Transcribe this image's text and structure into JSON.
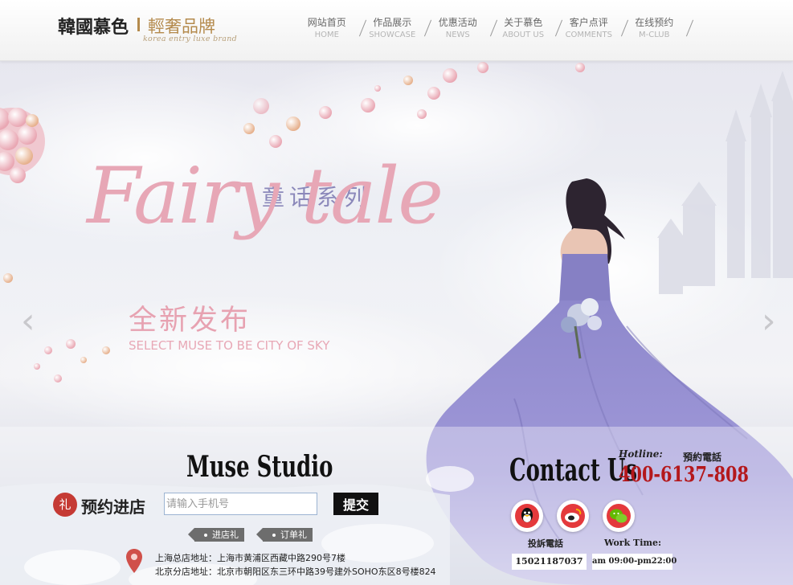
{
  "header": {
    "logo": {
      "main": "韓國慕色",
      "sub": "輕奢品牌",
      "tagline": "korea entry luxe brand"
    },
    "nav": [
      {
        "label": "网站首页",
        "sublabel": "HOME"
      },
      {
        "label": "作品展示",
        "sublabel": "SHOWCASE"
      },
      {
        "label": "优惠活动",
        "sublabel": "NEWS"
      },
      {
        "label": "关于慕色",
        "sublabel": "ABOUT US"
      },
      {
        "label": "客户点评",
        "sublabel": "COMMENTS"
      },
      {
        "label": "在线预约",
        "sublabel": "M-CLUB"
      }
    ]
  },
  "banner": {
    "series": "童话系列",
    "script": "Fairy tale",
    "headline": "全新发布",
    "tagline": "SELECT MUSE TO BE CITY OF SKY",
    "prev_icon": "chevron-left-icon",
    "next_icon": "chevron-right-icon",
    "prev_glyph": "‹",
    "next_glyph": "›"
  },
  "booking": {
    "studio_title": "Muse Studio",
    "gift_icon": "礼",
    "label": "预约进店",
    "phone_placeholder": "请输入手机号",
    "submit_label": "提交",
    "tags": [
      "进店礼",
      "订单礼"
    ],
    "address_shanghai": "上海总店地址：上海市黄浦区西藏中路290号7楼",
    "address_beijing": "北京分店地址：北京市朝阳区东三环中路39号建外SOHO东区8号楼824"
  },
  "contact": {
    "title": "Contact Us",
    "hotline_label": "Hotline:",
    "hotline_cn": "預約電話",
    "hotline_number": "400-6137-808",
    "social_icons": [
      "qq-icon",
      "weibo-icon",
      "wechat-icon"
    ],
    "complaint_label": "投訴電話",
    "complaint_number": "15021187037",
    "worktime_label": "Work Time:",
    "worktime_value": "am 09:00-pm22:00"
  },
  "colors": {
    "accent_gold": "#b48a4c",
    "banner_pink": "#e7a7b6",
    "series_purple": "#8b88ba",
    "dress_purple": "#8e88cc",
    "hotline_red": "#b4181c"
  }
}
